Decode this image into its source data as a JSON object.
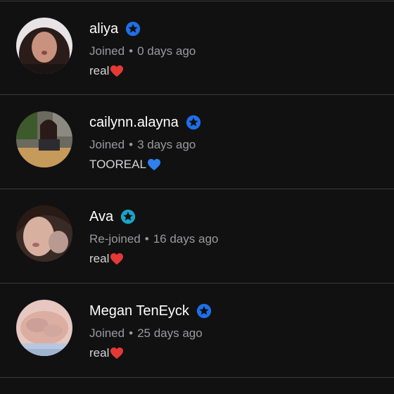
{
  "colors": {
    "background": "#111112",
    "divider": "#3a3a3c",
    "badge_blue": "#1f6feb",
    "badge_teal": "#1aa3c8",
    "heart_red": "#e53935",
    "heart_blue": "#2f80ed"
  },
  "members": [
    {
      "name": "aliya",
      "status": "Joined",
      "separator": "•",
      "time": "0 days ago",
      "note": "real",
      "note_icon": "red-heart-icon",
      "badge_icon": "star-badge-icon",
      "badge_color": "#1f6feb"
    },
    {
      "name": "cailynn.alayna",
      "status": "Joined",
      "separator": "•",
      "time": "3 days ago",
      "note": "TOOREAL",
      "note_icon": "blue-heart-icon",
      "badge_icon": "star-badge-icon",
      "badge_color": "#1f6feb"
    },
    {
      "name": "Ava",
      "status": "Re-joined",
      "separator": "•",
      "time": "16 days ago",
      "note": "real",
      "note_icon": "red-heart-icon",
      "badge_icon": "star-badge-icon",
      "badge_color": "#1aa3c8"
    },
    {
      "name": "Megan TenEyck",
      "status": "Joined",
      "separator": "•",
      "time": "25 days ago",
      "note": "real",
      "note_icon": "red-heart-icon",
      "badge_icon": "star-badge-icon",
      "badge_color": "#1f6feb"
    }
  ]
}
